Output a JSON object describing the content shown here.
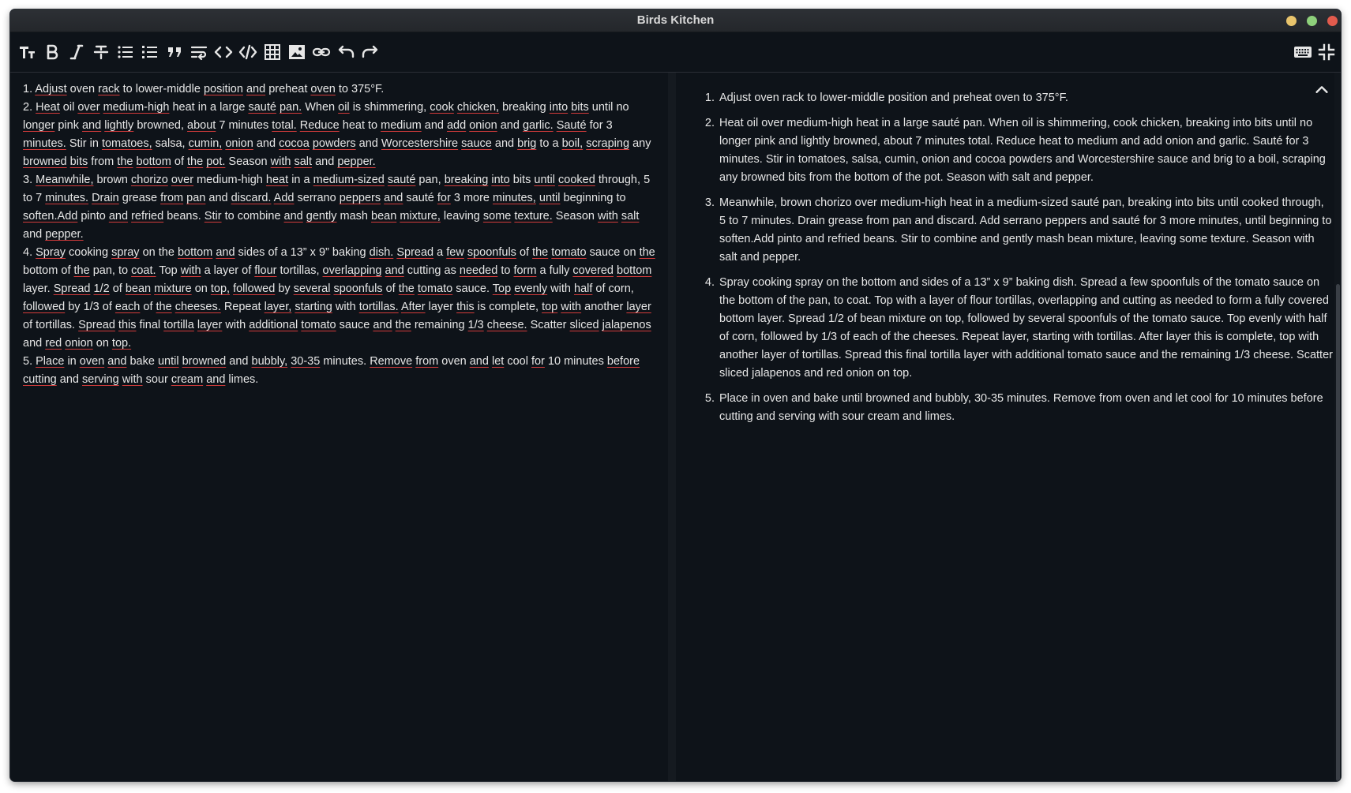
{
  "window": {
    "title": "Birds Kitchen",
    "controls": [
      "minimize",
      "maximize",
      "close"
    ]
  },
  "toolbar": {
    "left_icons": [
      "text-size-icon",
      "bold-icon",
      "italic-icon",
      "strikethrough-icon",
      "bullet-list-icon",
      "numbered-list-icon",
      "quote-icon",
      "wrap-icon",
      "code-icon",
      "code-block-icon",
      "table-icon",
      "image-icon",
      "link-icon",
      "undo-icon",
      "redo-icon"
    ],
    "right_icons": [
      "keyboard-icon",
      "exit-fullscreen-icon"
    ]
  },
  "editor": {
    "lines": [
      "1. Adjust oven rack to lower-middle position and preheat oven to 375°F.",
      "2. Heat oil over medium-high heat in a large sauté pan. When oil is shimmering, cook chicken, breaking into bits until no longer pink and lightly browned, about 7 minutes total. Reduce heat to medium and add onion and garlic. Sauté for 3 minutes. Stir in tomatoes, salsa, cumin, onion and cocoa powders and Worcestershire sauce and brig to a boil, scraping any browned bits from the bottom of the pot. Season with salt and pepper.",
      "3. Meanwhile, brown chorizo over medium-high heat in a medium-sized sauté pan, breaking into bits until cooked through, 5 to 7 minutes. Drain grease from pan and discard. Add serrano peppers and sauté for 3 more minutes, until beginning to soften.Add pinto and refried beans. Stir to combine and gently mash bean mixture, leaving some texture. Season with salt and pepper.",
      "4. Spray cooking spray on the bottom and sides of a 13” x 9” baking dish. Spread a few spoonfuls of the tomato sauce on the bottom of the pan, to coat. Top with a layer of flour tortillas, overlapping and cutting as needed to form a fully covered bottom layer. Spread 1/2 of bean mixture on top, followed by several spoonfuls of the tomato sauce. Top evenly with half of corn, followed by 1/3 of each of the cheeses. Repeat layer, starting with tortillas. After layer this is complete, top with another layer of tortillas. Spread this final tortilla layer with additional tomato sauce and the remaining 1/3 cheese. Scatter sliced jalapenos and red onion on top.",
      "5. Place in oven and bake until browned and bubbly, 30-35 minutes. Remove from oven and let cool for 10 minutes before cutting and serving with sour cream and limes."
    ]
  },
  "preview": {
    "items": [
      "Adjust oven rack to lower-middle position and preheat oven to 375°F.",
      "Heat oil over medium-high heat in a large sauté pan. When oil is shimmering, cook chicken, breaking into bits until no longer pink and lightly browned, about 7 minutes total. Reduce heat to medium and add onion and garlic. Sauté for 3 minutes. Stir in tomatoes, salsa, cumin, onion and cocoa powders and Worcestershire sauce and brig to a boil, scraping any browned bits from the bottom of the pot. Season with salt and pepper.",
      "Meanwhile, brown chorizo over medium-high heat in a medium-sized sauté pan, breaking into bits until cooked through, 5 to 7 minutes. Drain grease from pan and discard. Add serrano peppers and sauté for 3 more minutes, until beginning to soften.Add pinto and refried beans. Stir to combine and gently mash bean mixture, leaving some texture. Season with salt and pepper.",
      "Spray cooking spray on the bottom and sides of a 13” x 9” baking dish. Spread a few spoonfuls of the tomato sauce on the bottom of the pan, to coat. Top with a layer of flour tortillas, overlapping and cutting as needed to form a fully covered bottom layer. Spread 1/2 of bean mixture on top, followed by several spoonfuls of the tomato sauce. Top evenly with half of corn, followed by 1/3 of each of the cheeses. Repeat layer, starting with tortillas. After layer this is complete, top with another layer of tortillas. Spread this final tortilla layer with additional tomato sauce and the remaining 1/3 cheese. Scatter sliced jalapenos and red onion on top.",
      "Place in oven and bake until browned and bubbly, 30-35 minutes. Remove from oven and let cool for 10 minutes before cutting and serving with sour cream and limes."
    ]
  },
  "colors": {
    "background": "#0e1319",
    "text": "#e6e6e6",
    "spellcheck_underline": "#d33b3b",
    "close": "#e25b4d",
    "minimize": "#e8c46c",
    "maximize": "#8ed07b"
  }
}
